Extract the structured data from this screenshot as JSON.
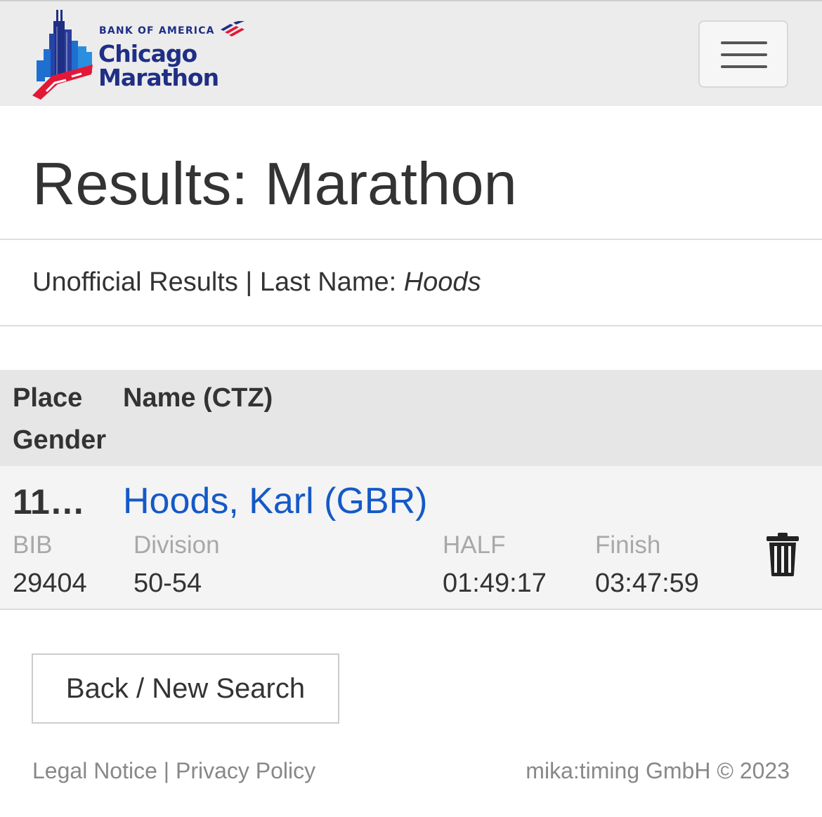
{
  "header": {
    "logo": {
      "sponsor": "BANK OF AMERICA",
      "line1": "Chicago",
      "line2": "Marathon"
    },
    "menu_icon": "hamburger-menu-icon"
  },
  "page": {
    "title": "Results: Marathon",
    "subtitle_prefix": "Unofficial Results | Last Name: ",
    "subtitle_value": "Hoods"
  },
  "table": {
    "headers": {
      "place": "Place",
      "gender": "Gender",
      "name": "Name (CTZ)"
    },
    "rows": [
      {
        "place": "11…",
        "name": "Hoods, Karl (GBR)",
        "bib_label": "BIB",
        "bib": "29404",
        "division_label": "Division",
        "division": "50-54",
        "half_label": "HALF",
        "half": "01:49:17",
        "finish_label": "Finish",
        "finish": "03:47:59",
        "action_icon": "trash-icon"
      }
    ]
  },
  "actions": {
    "back_label": "Back / New Search"
  },
  "footer": {
    "legal": "Legal Notice",
    "separator": " | ",
    "privacy": "Privacy Policy",
    "copyright": "mika:timing GmbH © 2023"
  },
  "colors": {
    "brand_blue": "#1f2f86",
    "brand_red": "#e31837",
    "link_blue": "#1459c7",
    "header_bg": "#ececec"
  }
}
